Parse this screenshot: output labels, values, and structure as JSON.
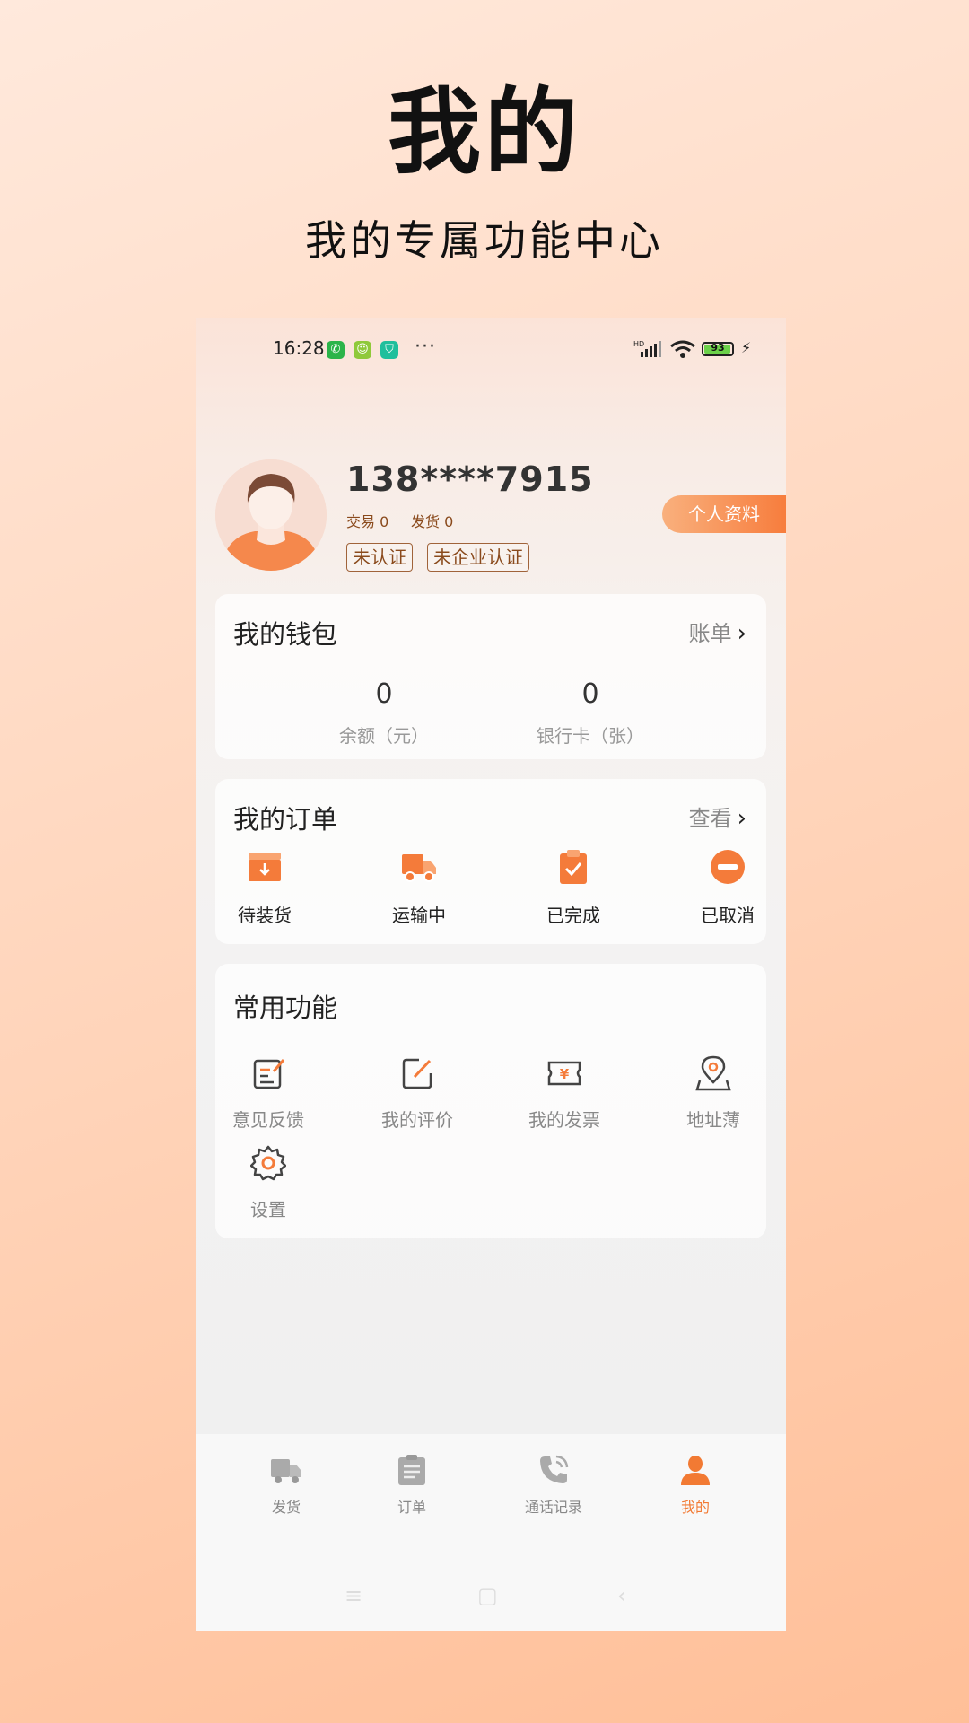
{
  "promo": {
    "title": "我的",
    "subtitle": "我的专属功能中心"
  },
  "status_bar": {
    "time": "16:28",
    "dots": "···",
    "battery": "93",
    "network": "HD"
  },
  "profile": {
    "phone": "138****7915",
    "trade_label": "交易 0",
    "ship_label": "发货 0",
    "tags": [
      "未认证",
      "未企业认证"
    ],
    "profile_button": "个人资料"
  },
  "wallet": {
    "title": "我的钱包",
    "link": "账单",
    "items": [
      {
        "value": "0",
        "label": "余额（元）"
      },
      {
        "value": "0",
        "label": "银行卡（张）"
      }
    ]
  },
  "orders": {
    "title": "我的订单",
    "link": "查看",
    "items": [
      {
        "label": "待装货",
        "icon": "box-down-icon"
      },
      {
        "label": "运输中",
        "icon": "truck-icon"
      },
      {
        "label": "已完成",
        "icon": "clipboard-check-icon"
      },
      {
        "label": "已取消",
        "icon": "minus-circle-icon"
      }
    ]
  },
  "functions": {
    "title": "常用功能",
    "items": [
      {
        "label": "意见反馈",
        "icon": "feedback-icon"
      },
      {
        "label": "我的评价",
        "icon": "edit-icon"
      },
      {
        "label": "我的发票",
        "icon": "invoice-icon"
      },
      {
        "label": "地址薄",
        "icon": "location-pin-icon"
      },
      {
        "label": "设置",
        "icon": "gear-icon"
      }
    ]
  },
  "bottom_nav": {
    "items": [
      {
        "label": "发货",
        "icon": "truck-icon"
      },
      {
        "label": "订单",
        "icon": "document-icon"
      },
      {
        "label": "通话记录",
        "icon": "phone-icon"
      },
      {
        "label": "我的",
        "icon": "person-icon",
        "active": true
      }
    ]
  },
  "colors": {
    "accent": "#f27a33",
    "tag_border": "#a0633a"
  }
}
